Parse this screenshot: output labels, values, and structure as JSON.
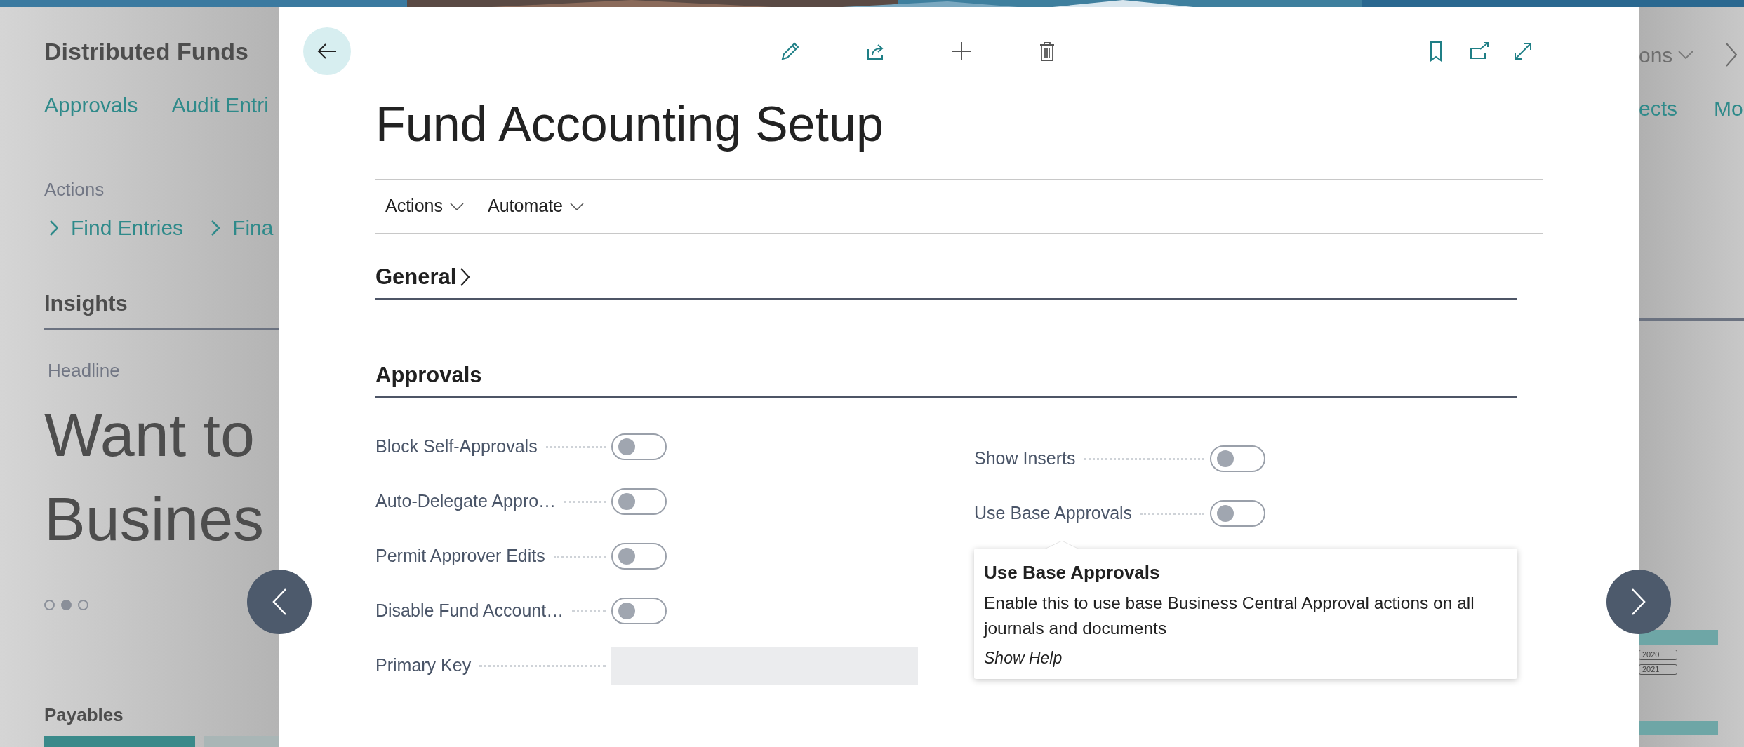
{
  "background_page": {
    "title": "Distributed Funds",
    "links": [
      "Approvals",
      "Audit Entri"
    ],
    "actions_label": "Actions",
    "actions": [
      "Find Entries",
      "Fina"
    ],
    "insights_title": "Insights",
    "headline_label": "Headline",
    "headline_lines": [
      "Want to",
      "Busines"
    ],
    "carousel_dots": [
      {
        "selected": false
      },
      {
        "selected": true
      },
      {
        "selected": false
      }
    ],
    "payables_title": "Payables",
    "right_menu": "ons",
    "right_links": [
      "ects",
      "Mo"
    ],
    "legend": [
      "2020",
      "2021"
    ]
  },
  "dialog": {
    "title": "Fund Accounting Setup",
    "menus": [
      "Actions",
      "Automate"
    ],
    "sections": [
      {
        "title": "General",
        "expanded": false
      },
      {
        "title": "Approvals",
        "expanded": true,
        "columns": [
          [
            {
              "label": "Block Self-Approvals",
              "kind": "toggle",
              "on": false
            },
            {
              "label": "Auto-Delegate Appro…",
              "kind": "toggle",
              "on": false
            },
            {
              "label": "Permit Approver Edits",
              "kind": "toggle",
              "on": false
            },
            {
              "label": "Disable Fund Account…",
              "kind": "toggle",
              "on": false
            },
            {
              "label": "Primary Key",
              "kind": "text"
            }
          ],
          [
            {
              "label": "Show Inserts",
              "kind": "toggle",
              "on": false
            },
            {
              "label": "Use Base Approvals",
              "kind": "toggle",
              "on": false
            }
          ]
        ]
      }
    ],
    "tooltip": {
      "title": "Use Base Approvals",
      "text": "Enable this to use base Business Central Approval actions on all journals and documents",
      "link": "Show Help"
    }
  }
}
